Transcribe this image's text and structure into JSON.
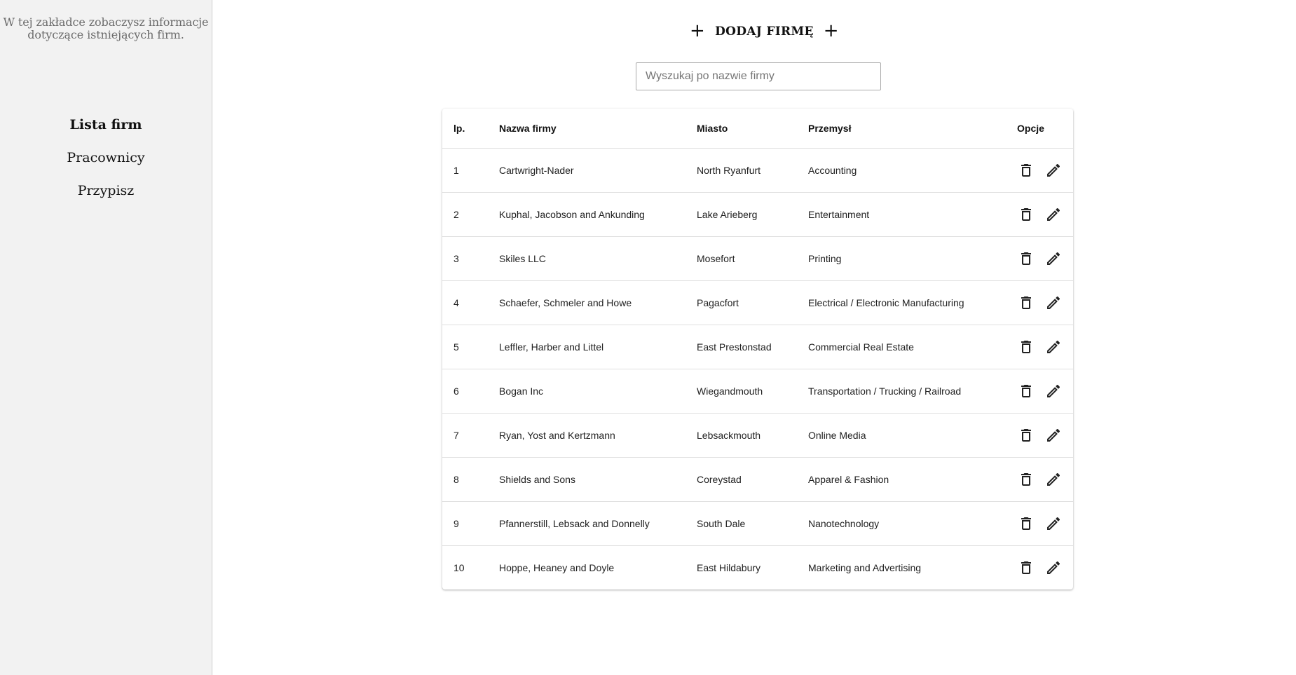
{
  "sidebar": {
    "description": "W tej zakładce zobaczysz informacje dotyczące istniejących firm.",
    "items": [
      {
        "label": "Lista firm",
        "active": true
      },
      {
        "label": "Pracownicy",
        "active": false
      },
      {
        "label": "Przypisz",
        "active": false
      }
    ]
  },
  "toolbar": {
    "add_label": "DODAJ FIRMĘ",
    "add_icon": "plus-icon"
  },
  "search": {
    "placeholder": "Wyszukaj po nazwie firmy",
    "value": ""
  },
  "table": {
    "headers": {
      "lp": "lp.",
      "name": "Nazwa firmy",
      "city": "Miasto",
      "industry": "Przemysł",
      "options": "Opcje"
    },
    "rows": [
      {
        "lp": "1",
        "name": "Cartwright-Nader",
        "city": "North Ryanfurt",
        "industry": "Accounting"
      },
      {
        "lp": "2",
        "name": "Kuphal, Jacobson and Ankunding",
        "city": "Lake Arieberg",
        "industry": "Entertainment"
      },
      {
        "lp": "3",
        "name": "Skiles LLC",
        "city": "Mosefort",
        "industry": "Printing"
      },
      {
        "lp": "4",
        "name": "Schaefer, Schmeler and Howe",
        "city": "Pagacfort",
        "industry": "Electrical / Electronic Manufacturing"
      },
      {
        "lp": "5",
        "name": "Leffler, Harber and Littel",
        "city": "East Prestonstad",
        "industry": "Commercial Real Estate"
      },
      {
        "lp": "6",
        "name": "Bogan Inc",
        "city": "Wiegandmouth",
        "industry": "Transportation / Trucking / Railroad"
      },
      {
        "lp": "7",
        "name": "Ryan, Yost and Kertzmann",
        "city": "Lebsackmouth",
        "industry": "Online Media"
      },
      {
        "lp": "8",
        "name": "Shields and Sons",
        "city": "Coreystad",
        "industry": "Apparel & Fashion"
      },
      {
        "lp": "9",
        "name": "Pfannerstill, Lebsack and Donnelly",
        "city": "South Dale",
        "industry": "Nanotechnology"
      },
      {
        "lp": "10",
        "name": "Hoppe, Heaney and Doyle",
        "city": "East Hildabury",
        "industry": "Marketing and Advertising"
      }
    ],
    "row_icons": {
      "delete": "trash-icon",
      "edit": "pencil-icon"
    }
  }
}
